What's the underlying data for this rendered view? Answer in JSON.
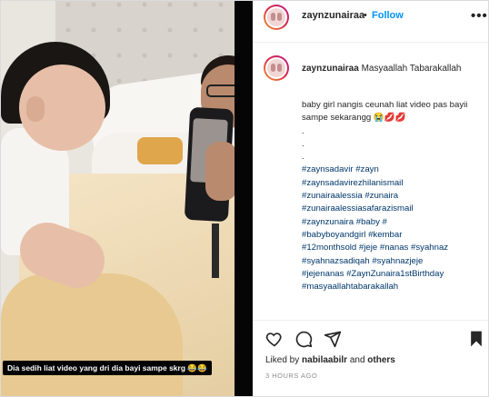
{
  "media": {
    "caption_overlay": "Dia sedih liat video yang dri dia bayi sampe skrg 😂😂"
  },
  "header": {
    "username": "zaynzunairaa",
    "separator": "•",
    "follow_label": "Follow",
    "more_label": "•••"
  },
  "post": {
    "username": "zaynzunairaa",
    "title": "Masyaallah Tabarakallah",
    "body_line1": "baby girl nangis ceunah liat video pas bayii sampe sekarangg 😭💋💋",
    "dots": [
      ".",
      ".",
      "."
    ],
    "hashtags": [
      "#zaynsadavir #zayn",
      "#zaynsadavirezhilanismail",
      "#zunairaalessia #zunaira",
      "#zunairaalessiasafarazismail",
      "#zaynzunaira #baby #",
      "#babyboyandgirl #kembar",
      "#12monthsold #jeje #nanas #syahnaz",
      "#syahnazsadiqah #syahnazjeje",
      "#jejenanas #ZaynZunaira1stBirthday",
      "#masyaallahtabarakallah"
    ]
  },
  "footer": {
    "liked_by_prefix": "Liked by",
    "liked_by_user": "nabilaabilr",
    "liked_by_suffix": "and",
    "liked_by_others": "others",
    "timestamp": "3 HOURS AGO"
  },
  "icons": [
    "heart-icon",
    "comment-icon",
    "share-icon",
    "bookmark-icon"
  ]
}
